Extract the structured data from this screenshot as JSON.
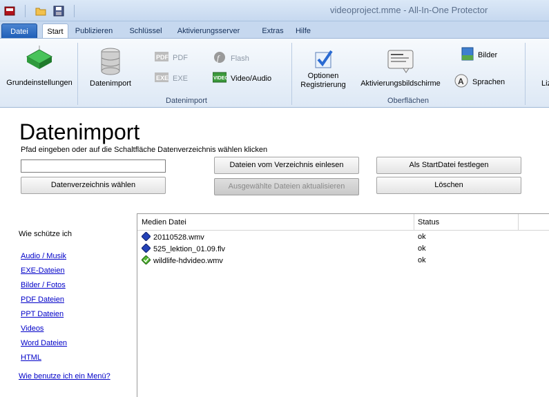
{
  "window": {
    "title": "videoproject.mme - All-In-One Protector"
  },
  "tabs": [
    {
      "label": "Datei"
    },
    {
      "label": "Start"
    },
    {
      "label": "Publizieren"
    },
    {
      "label": "Schlüssel"
    },
    {
      "label": "Aktivierungsserver"
    },
    {
      "label": "Extras"
    },
    {
      "label": "Hilfe"
    }
  ],
  "ribbon": {
    "grundeinstellungen": "Grundeinstellungen",
    "datenimport": "Datenimport",
    "pdf": "PDF",
    "exe": "EXE",
    "flash": "Flash",
    "video_audio": "Video/Audio",
    "optionen_line1": "Optionen",
    "optionen_line2": "Registrierung",
    "aktivierungsbildschirme": "Aktivierungsbildschirme",
    "bilder": "Bilder",
    "sprachen": "Sprachen",
    "cut_label": "Liz",
    "group_datenimport": "Datenimport",
    "group_oberflaechen": "Oberflächen"
  },
  "main": {
    "title": "Datenimport",
    "hint": "Pfad eingeben oder auf die Schaltfläche Datenverzeichnis wählen klicken",
    "path_value": "",
    "buttons": {
      "einlesen": "Dateien vom Verzeichnis einlesen",
      "startdatei": "Als StartDatei festlegen",
      "verzeichnis": "Datenverzeichnis wählen",
      "aktualisieren": "Ausgewählte Dateien aktualisieren",
      "loeschen": "Löschen"
    }
  },
  "help": {
    "heading": "Wie schütze ich",
    "links": [
      "Audio / Musik",
      "EXE-Dateien",
      "Bilder / Fotos",
      "PDF Dateien",
      "PPT Dateien",
      "Videos",
      "Word Dateien",
      "HTML"
    ],
    "menu_link": "Wie benutze ich ein Menü?"
  },
  "table": {
    "columns": [
      "Medien Datei",
      "Status"
    ],
    "rows": [
      {
        "file": "20110528.wmv",
        "status": "ok",
        "icon": "diamond-blue"
      },
      {
        "file": "525_lektion_01.09.flv",
        "status": "ok",
        "icon": "diamond-blue"
      },
      {
        "file": "wildlife-hdvideo.wmv",
        "status": "ok",
        "icon": "diamond-green-check"
      }
    ]
  },
  "colors": {
    "accent": "#1f5fb8",
    "link": "#0000c8",
    "ribbon_bg": "#dde8f5"
  }
}
